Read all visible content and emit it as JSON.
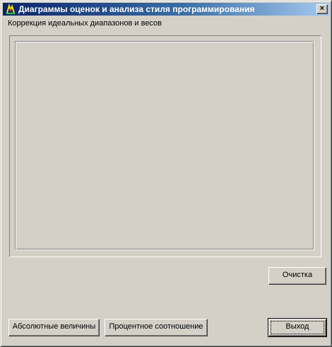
{
  "window": {
    "title": "Диаграммы оценок и анализа стиля программирования",
    "close_label": "×"
  },
  "caption": "Коррекция идеальных диапазонов и весов",
  "buttons": {
    "clear": "Очистка",
    "absolute": "Абсолютные величины",
    "percent": "Процентное соотношение",
    "exit": "Выход"
  },
  "icons": {
    "app": "app-icon",
    "close": "close-icon"
  },
  "colors": {
    "face": "#d4d0c8",
    "title_start": "#0a246a",
    "title_end": "#a6caf0"
  }
}
